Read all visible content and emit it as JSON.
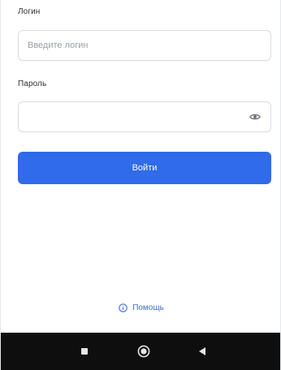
{
  "login": {
    "label": "Логин",
    "placeholder": "Введите логин",
    "value": ""
  },
  "password": {
    "label": "Пароль",
    "value": "",
    "toggle_icon": "eye-icon"
  },
  "submit": {
    "label": "Войти",
    "color": "#2f6bea"
  },
  "help": {
    "label": "Помощь",
    "icon": "info-icon",
    "color": "#3c6fd6"
  },
  "nav": {
    "buttons": [
      "recents-icon",
      "home-icon",
      "back-icon"
    ]
  }
}
